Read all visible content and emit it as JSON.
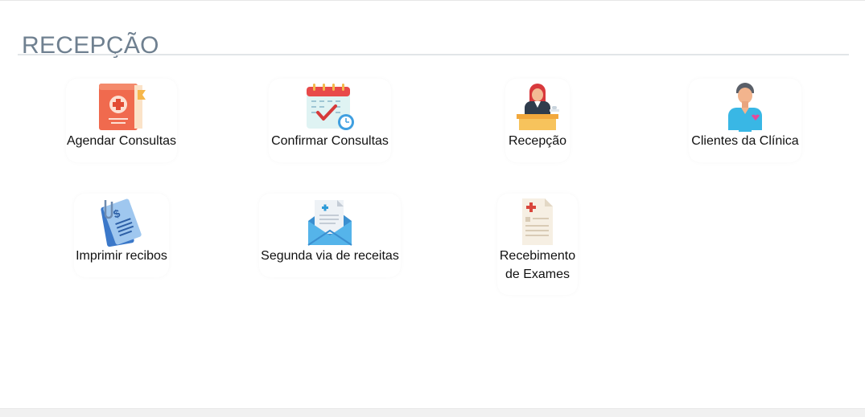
{
  "page": {
    "title": "RECEPÇÃO"
  },
  "tiles": [
    {
      "label": "Agendar Consultas",
      "icon": "medical-book-icon"
    },
    {
      "label": "Confirmar Consultas",
      "icon": "calendar-check-icon"
    },
    {
      "label": "Recepção",
      "icon": "receptionist-icon"
    },
    {
      "label": "Clientes da Clínica",
      "icon": "patient-icon"
    },
    {
      "label": "Imprimir recibos",
      "icon": "receipt-icon"
    },
    {
      "label": "Segunda via de receitas",
      "icon": "prescription-envelope-icon"
    },
    {
      "label_line1": "Recebimento",
      "label_line2": "de Exames",
      "icon": "exam-document-icon"
    }
  ],
  "colors": {
    "title": "#6f8090",
    "divider": "#e2e5e8"
  }
}
